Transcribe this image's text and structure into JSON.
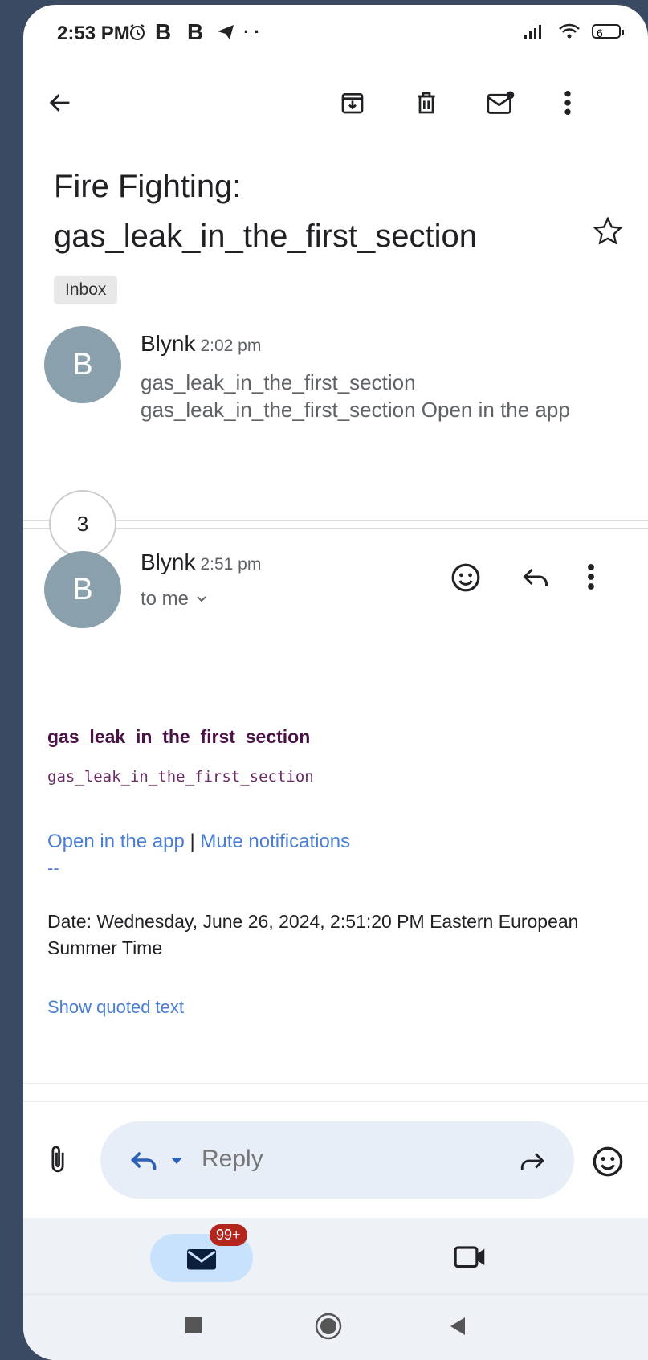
{
  "status_bar": {
    "time": "2:53 PM",
    "app_icons": "B B",
    "battery": "6"
  },
  "toolbar": {
    "back": "back-arrow-icon",
    "archive": "archive-icon",
    "delete": "trash-icon",
    "mark_unread": "mail-unread-icon",
    "more": "more-vert-icon"
  },
  "subject": {
    "line1": "Fire Fighting:",
    "line2": "gas_leak_in_the_first_section",
    "label": "Inbox"
  },
  "message1": {
    "avatar": "B",
    "sender": "Blynk",
    "time": "2:02 pm",
    "snippet1": "gas_leak_in_the_first_section",
    "snippet2": "gas_leak_in_the_first_section Open in the app"
  },
  "collapsed": {
    "count": "3"
  },
  "message2": {
    "avatar": "B",
    "sender": "Blynk",
    "time": "2:51 pm",
    "recipient": "to me",
    "body_title": "gas_leak_in_the_first_section",
    "body_mono": "gas_leak_in_the_first_section",
    "link_open": "Open in the app",
    "link_sep": "|",
    "link_mute": "Mute notifications",
    "dashes": "--",
    "date": "Date: Wednesday, June 26, 2024, 2:51:20 PM Eastern European Summer Time",
    "show_quoted": "Show quoted text"
  },
  "reply_bar": {
    "placeholder": "Reply"
  },
  "bottom_nav": {
    "badge": "99+"
  },
  "colors": {
    "avatar": "#8aa1ad",
    "link": "#4a7dd6",
    "reply_pill": "#e7eef8",
    "badge": "#b3261e"
  }
}
